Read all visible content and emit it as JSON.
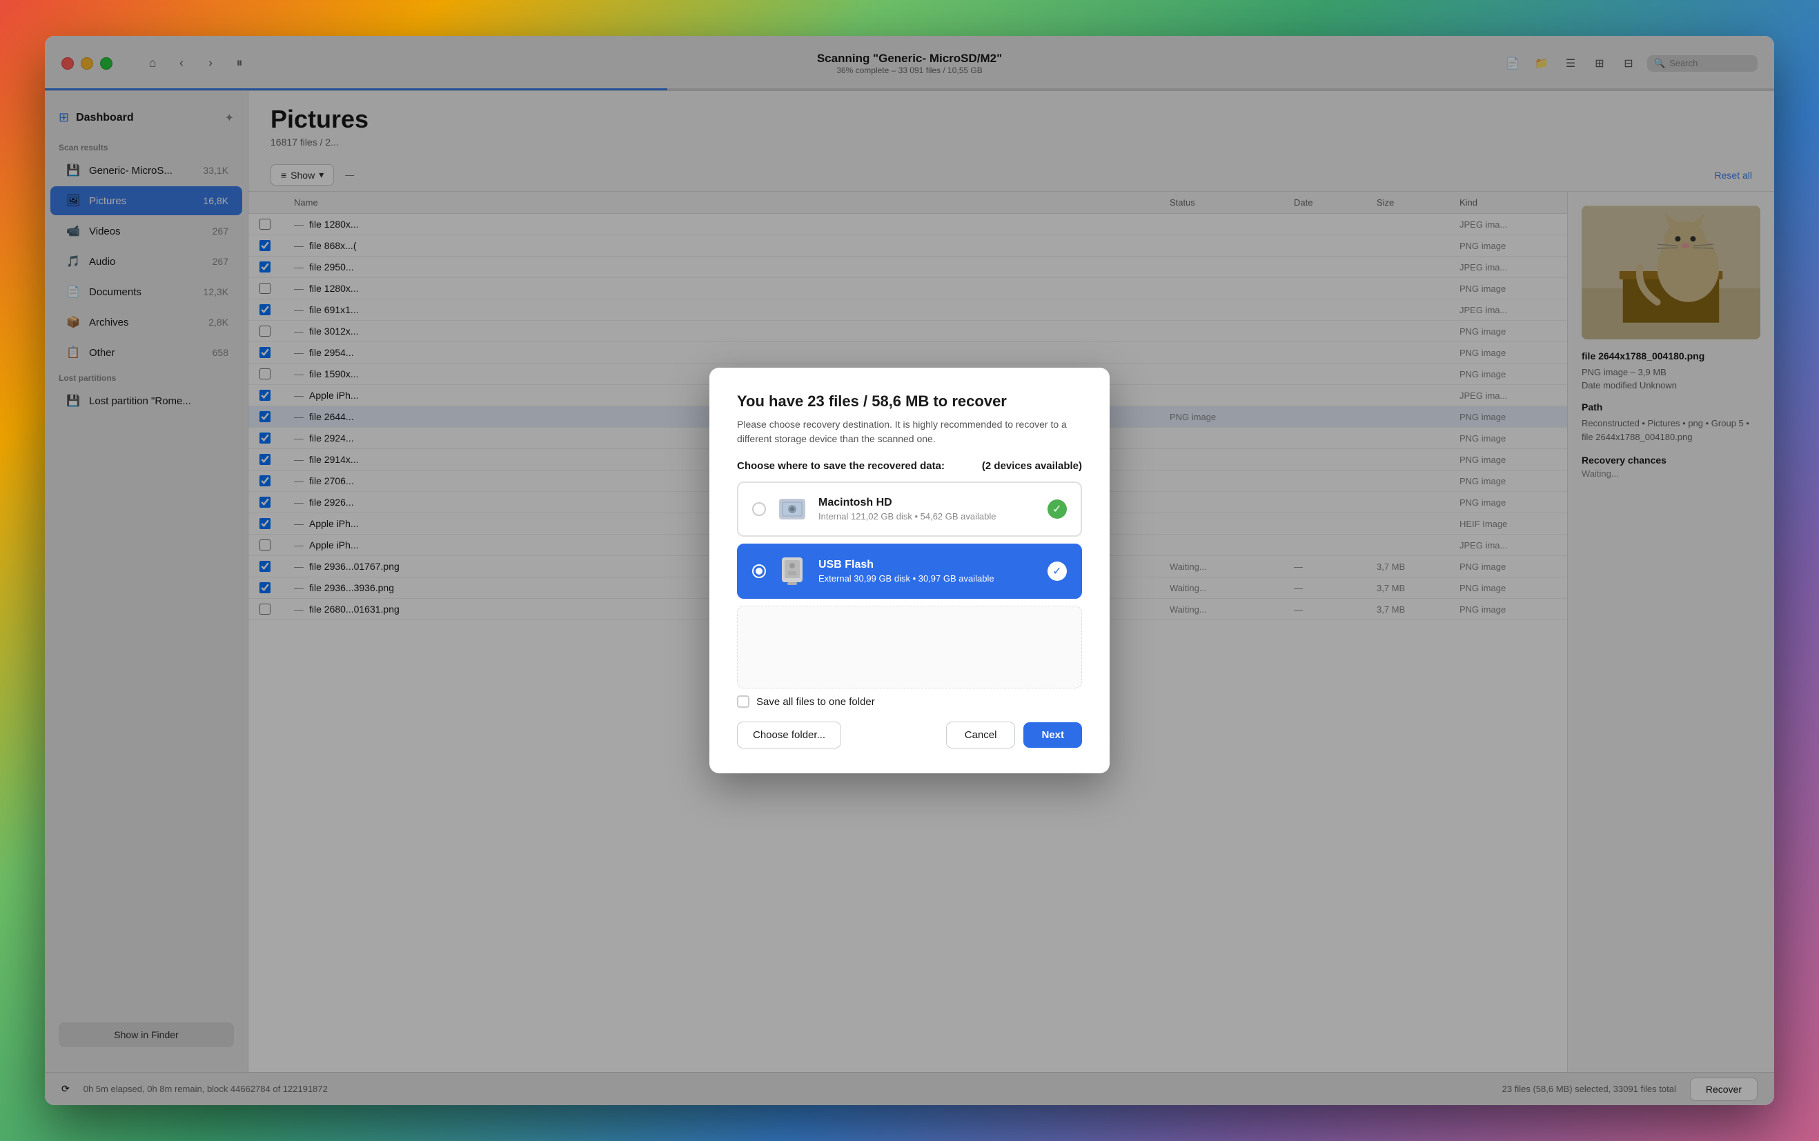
{
  "window": {
    "title": "Scanning \"Generic- MicroSD/M2\"",
    "subtitle": "36% complete – 33 091 files / 10,55 GB",
    "progress_percent": 36
  },
  "toolbar": {
    "home_icon": "⌂",
    "back_icon": "‹",
    "forward_icon": "›",
    "pause_icon": "⏸",
    "search_placeholder": "Search"
  },
  "sidebar": {
    "dashboard_label": "Dashboard",
    "scan_results_title": "Scan results",
    "items": [
      {
        "id": "generic-micros",
        "icon": "💾",
        "label": "Generic- MicroS...",
        "count": "33,1K",
        "active": false
      },
      {
        "id": "pictures",
        "icon": "🖼",
        "label": "Pictures",
        "count": "16,8K",
        "active": true
      },
      {
        "id": "videos",
        "icon": "📹",
        "label": "Videos",
        "count": "267",
        "active": false
      },
      {
        "id": "audio",
        "icon": "🎵",
        "label": "Audio",
        "count": "267",
        "active": false
      },
      {
        "id": "documents",
        "icon": "📄",
        "label": "Documents",
        "count": "12,3K",
        "active": false
      },
      {
        "id": "archives",
        "icon": "📦",
        "label": "Archives",
        "count": "2,8K",
        "active": false
      },
      {
        "id": "other",
        "icon": "📋",
        "label": "Other",
        "count": "658",
        "active": false
      }
    ],
    "lost_partitions_title": "Lost partitions",
    "lost_partitions": [
      {
        "id": "lost-partition",
        "icon": "💾",
        "label": "Lost partition \"Rome...",
        "count": ""
      }
    ],
    "show_in_finder": "Show in Finder"
  },
  "main": {
    "title": "Pictures",
    "subtitle": "16817 files / 2...",
    "show_filter": "Show",
    "reset_all": "Reset all",
    "columns": [
      "",
      "Name",
      "Status",
      "Date",
      "Size",
      "Kind"
    ],
    "rows": [
      {
        "checked": false,
        "name": "file 1280x...",
        "status": "",
        "date": "",
        "size": "",
        "kind": ""
      },
      {
        "checked": true,
        "name": "file 868x...(",
        "status": "",
        "date": "",
        "size": "",
        "kind": ""
      },
      {
        "checked": true,
        "name": "file 2950...",
        "status": "",
        "date": "",
        "size": "",
        "kind": ""
      },
      {
        "checked": false,
        "name": "file 1280x...",
        "status": "",
        "date": "",
        "size": "",
        "kind": ""
      },
      {
        "checked": true,
        "name": "file 691x1...",
        "status": "",
        "date": "",
        "size": "",
        "kind": ""
      },
      {
        "checked": false,
        "name": "file 3012x...",
        "status": "",
        "date": "",
        "size": "",
        "kind": ""
      },
      {
        "checked": true,
        "name": "file 2954...",
        "status": "",
        "date": "",
        "size": "",
        "kind": ""
      },
      {
        "checked": false,
        "name": "file 1590x...",
        "status": "",
        "date": "",
        "size": "",
        "kind": ""
      },
      {
        "checked": true,
        "name": "Apple iPh...",
        "status": "",
        "date": "",
        "size": "",
        "kind": ""
      },
      {
        "checked": true,
        "name": "file 2644...",
        "status": "PNG image",
        "date": "",
        "size": "",
        "kind": ""
      },
      {
        "checked": true,
        "name": "file 2924...",
        "status": "",
        "date": "",
        "size": "",
        "kind": ""
      },
      {
        "checked": true,
        "name": "file 2914x...",
        "status": "",
        "date": "",
        "size": "",
        "kind": ""
      },
      {
        "checked": true,
        "name": "file 2706...",
        "status": "",
        "date": "",
        "size": "",
        "kind": ""
      },
      {
        "checked": true,
        "name": "file 2926...",
        "status": "",
        "date": "",
        "size": "",
        "kind": ""
      },
      {
        "checked": true,
        "name": "Apple iPh...",
        "status": "",
        "date": "",
        "size": "",
        "kind": ""
      },
      {
        "checked": false,
        "name": "Apple iPh...",
        "status": "",
        "date": "",
        "size": "",
        "kind": ""
      },
      {
        "checked": true,
        "name": "file 2936...01767.png",
        "status": "Waiting...",
        "date": "—",
        "size": "3,7 MB",
        "kind": "PNG image"
      },
      {
        "checked": true,
        "name": "file 2936...3936.png",
        "status": "Waiting...",
        "date": "—",
        "size": "3,7 MB",
        "kind": "PNG image"
      },
      {
        "checked": false,
        "name": "file 2680...01631.png",
        "status": "Waiting...",
        "date": "—",
        "size": "3,7 MB",
        "kind": "PNG image"
      }
    ]
  },
  "preview": {
    "filename": "file 2644x1788_004180.png",
    "meta1": "PNG image – 3,9 MB",
    "meta2": "Date modified  Unknown",
    "path_title": "Path",
    "path": "Reconstructed • Pictures • png • Group 5 • file 2644x1788_004180.png",
    "recovery_chances_title": "Recovery chances",
    "recovery_chances": "Waiting...",
    "kind_label": "Kind",
    "kind_values": [
      "JPEG ima...",
      "PNG image",
      "JPEG ima...",
      "PNG image",
      "JPEG ima...",
      "PNG image",
      "HEIF Image",
      "JPEG ima..."
    ]
  },
  "modal": {
    "title": "You have 23 files / 58,6 MB to recover",
    "description": "Please choose recovery destination. It is highly recommended to recover to a different storage device than the scanned one.",
    "choose_label": "Choose where to save the recovered data:",
    "devices_available": "(2 devices available)",
    "devices": [
      {
        "id": "macintosh-hd",
        "name": "Macintosh HD",
        "details": "Internal 121,02 GB disk • 54,62 GB available",
        "selected": false,
        "type": "hd"
      },
      {
        "id": "usb-flash",
        "name": "USB Flash",
        "details": "External 30,99 GB disk • 30,97 GB available",
        "selected": true,
        "type": "usb"
      }
    ],
    "save_all_label": "Save all files to one folder",
    "save_all_checked": false,
    "choose_folder_btn": "Choose folder...",
    "cancel_btn": "Cancel",
    "next_btn": "Next"
  },
  "status_bar": {
    "elapsed": "0h 5m elapsed, 0h 8m remain, block 44662784 of 122191872",
    "selected": "23 files (58,6 MB) selected, 33091 files total",
    "recover_btn": "Recover"
  }
}
